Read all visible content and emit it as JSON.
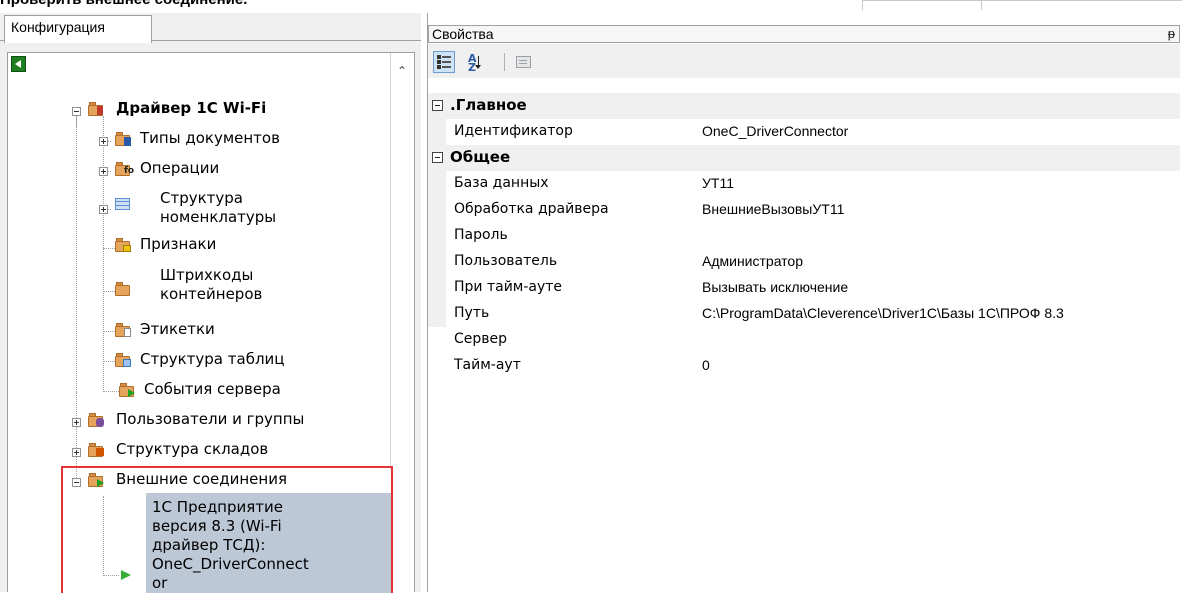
{
  "page": {
    "caption": "Проверить внешнее соединение."
  },
  "config_panel": {
    "tab_label": "Конфигурация",
    "tree": {
      "root": "Драйвер 1С Wi-Fi",
      "children": {
        "doc_types": "Типы документов",
        "operations": "Операции",
        "nomenclature_l1": "Структура",
        "nomenclature_l2": "номенклатуры",
        "attributes": "Признаки",
        "barcodes_l1": "Штрихкоды",
        "barcodes_l2": "контейнеров",
        "labels": "Этикетки",
        "tables": "Структура таблиц",
        "server_events": "События сервера"
      },
      "users": "Пользователи и группы",
      "warehouses": "Структура складов",
      "external": "Внешние соединения",
      "connection_lines": [
        "1С Предприятие",
        "версия 8.3 (Wi-Fi",
        "драйвер ТСД):",
        "OneC_DriverConnect",
        "or"
      ]
    }
  },
  "properties_panel": {
    "title": "Свойства",
    "pin_glyph": "ᵽ",
    "toolbar": {
      "categorized": "categorized-icon",
      "alphabetical": "sort-az-icon",
      "pages": "property-pages-icon"
    },
    "categories": [
      {
        "name": ".Главное",
        "rows": [
          {
            "name": "Идентификатор",
            "value": "OneC_DriverConnector"
          }
        ]
      },
      {
        "name": "Общее",
        "rows": [
          {
            "name": "База данных",
            "value": "УТ11"
          },
          {
            "name": "Обработка драйвера",
            "value": "ВнешниеВызовыУТ11"
          },
          {
            "name": "Пароль",
            "value": ""
          },
          {
            "name": "Пользователь",
            "value": "Администратор"
          },
          {
            "name": "При тайм-ауте",
            "value": "Вызывать исключение"
          },
          {
            "name": "Путь",
            "value": "C:\\ProgramData\\Cleverence\\Driver1C\\Базы 1С\\ПРОФ 8.3"
          },
          {
            "name": "Сервер",
            "value": ""
          },
          {
            "name": "Тайм-аут",
            "value": "0"
          }
        ]
      }
    ]
  },
  "colors": {
    "highlight": "#e23434",
    "selection": "#bdc8d6",
    "folder": "#e6a35c"
  }
}
